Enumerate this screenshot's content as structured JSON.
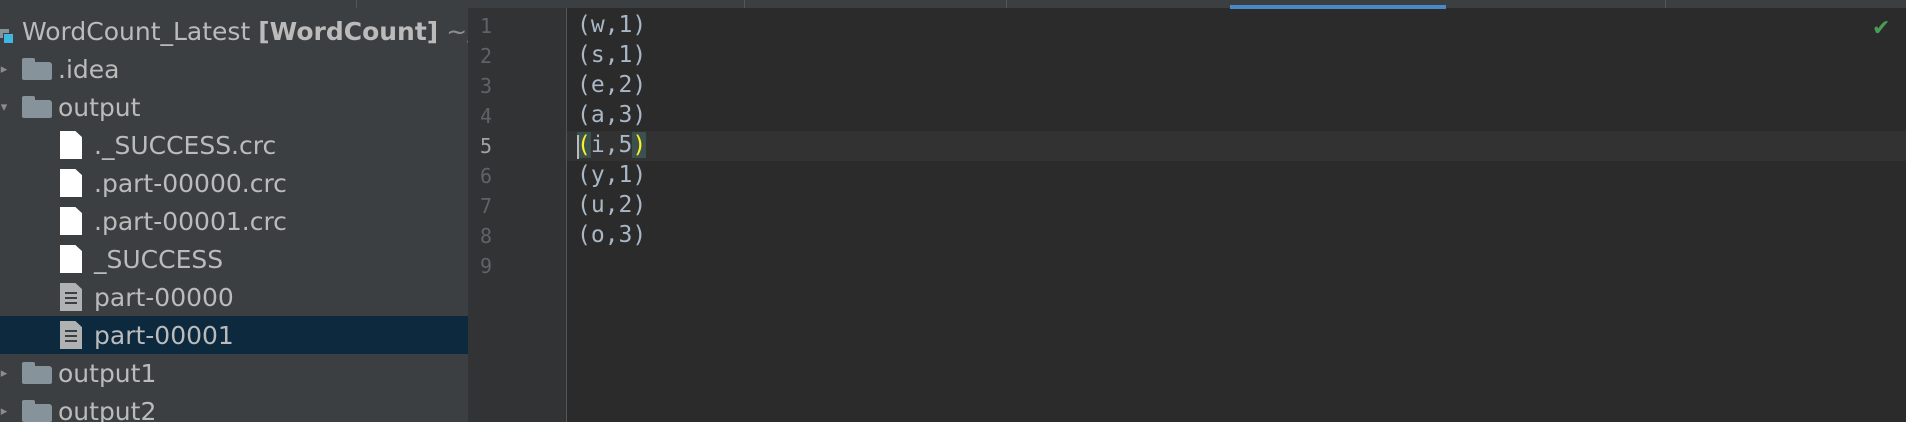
{
  "project": {
    "name": "WordCount_Latest",
    "module": "[WordCount]",
    "path_fragment": "~/"
  },
  "tree": [
    {
      "label": ".idea",
      "type": "folder"
    },
    {
      "label": "output",
      "type": "folder"
    },
    {
      "label": "._SUCCESS.crc",
      "type": "file"
    },
    {
      "label": ".part-00000.crc",
      "type": "file"
    },
    {
      "label": ".part-00001.crc",
      "type": "file"
    },
    {
      "label": "_SUCCESS",
      "type": "file"
    },
    {
      "label": "part-00000",
      "type": "text-file"
    },
    {
      "label": "part-00001",
      "type": "text-file",
      "selected": true
    },
    {
      "label": "output1",
      "type": "folder"
    },
    {
      "label": "output2",
      "type": "folder"
    }
  ],
  "editor": {
    "line_numbers": [
      "1",
      "2",
      "3",
      "4",
      "5",
      "6",
      "7",
      "8",
      "9"
    ],
    "lines": [
      "(w,1)",
      "(s,1)",
      "(e,2)",
      "(a,3)",
      "(i,5)",
      "(y,1)",
      "(u,2)",
      "(o,3)",
      ""
    ],
    "caret_line": 5,
    "line5_parts": {
      "open": "(",
      "mid": "i,5",
      "close": ")"
    },
    "status_icon": "check-icon"
  },
  "colors": {
    "selection": "#0d293e",
    "paren_match": "#ffef28",
    "check": "#499c54"
  }
}
